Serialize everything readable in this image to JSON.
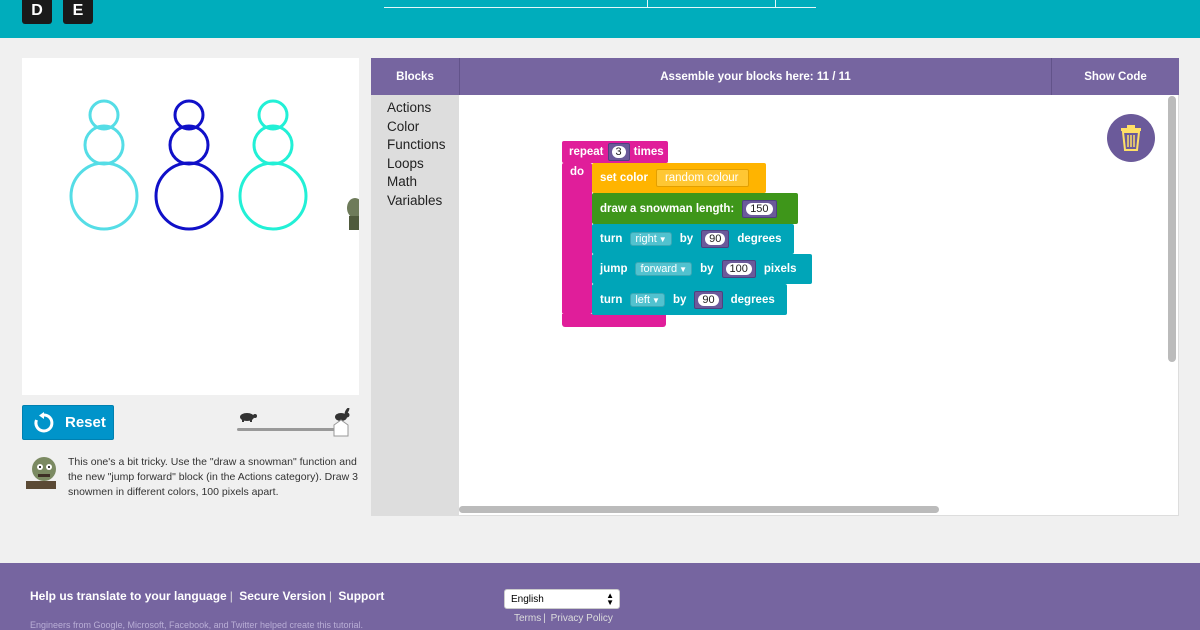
{
  "header": {
    "logo_letters": [
      "D",
      "E"
    ]
  },
  "canvas": {
    "snowman_colors": [
      "#55dde6",
      "#1010c8",
      "#22f0d6"
    ]
  },
  "controls": {
    "reset_label": "Reset",
    "speed_level": 1.0
  },
  "instructions": {
    "text": "This one's a bit tricky. Use the \"draw a snowman\" function and the new \"jump forward\" block (in the Actions category). Draw 3 snowmen in different colors, 100 pixels apart."
  },
  "workspace_header": {
    "blocks_label": "Blocks",
    "assemble_label": "Assemble your blocks here: 11 / 11",
    "show_code_label": "Show Code"
  },
  "toolbox": {
    "categories": [
      "Actions",
      "Color",
      "Functions",
      "Loops",
      "Math",
      "Variables"
    ]
  },
  "blocks": {
    "repeat": {
      "label_pre": "repeat",
      "count": "3",
      "label_post": "times",
      "do_label": "do"
    },
    "set_color": {
      "label": "set color",
      "value": "random colour"
    },
    "snowman": {
      "label": "draw a snowman  length:",
      "length": "150"
    },
    "turn1": {
      "label": "turn",
      "dir": "right",
      "by": "by",
      "amount": "90",
      "unit": "degrees"
    },
    "jump": {
      "label": "jump",
      "dir": "forward",
      "by": "by",
      "amount": "100",
      "unit": "pixels"
    },
    "turn2": {
      "label": "turn",
      "dir": "left",
      "by": "by",
      "amount": "90",
      "unit": "degrees"
    }
  },
  "footer": {
    "links": [
      "Help us translate to your language",
      "Secure Version",
      "Support"
    ],
    "credits": "Engineers from Google, Microsoft, Facebook, and Twitter helped create this tutorial.",
    "language": "English",
    "terms": "Terms",
    "privacy": "Privacy Policy"
  },
  "colors": {
    "topbar": "#00adbc",
    "purple": "#7665a0",
    "repeat_block": "#e01e9a",
    "color_block": "#ffb400",
    "function_block": "#3e961a",
    "action_block": "#00a5b8"
  }
}
